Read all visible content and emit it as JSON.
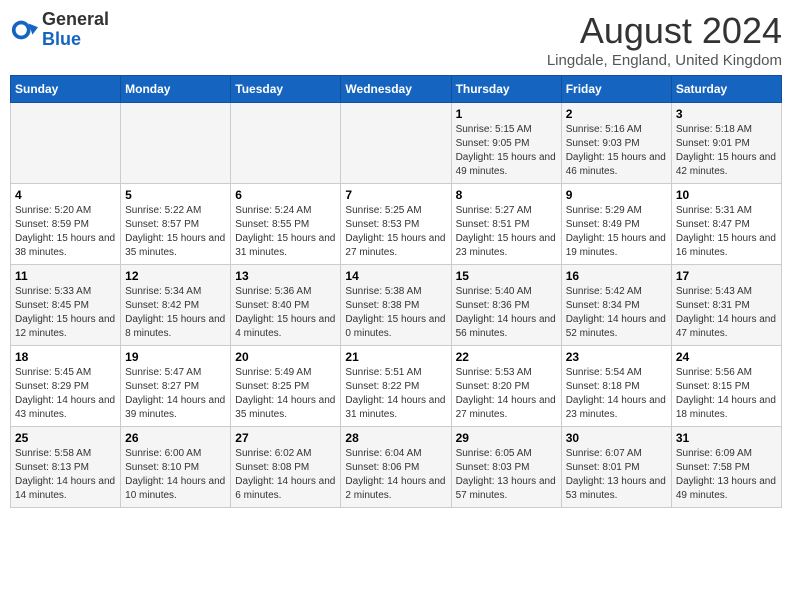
{
  "header": {
    "logo_general": "General",
    "logo_blue": "Blue",
    "month_title": "August 2024",
    "location": "Lingdale, England, United Kingdom"
  },
  "days_of_week": [
    "Sunday",
    "Monday",
    "Tuesday",
    "Wednesday",
    "Thursday",
    "Friday",
    "Saturday"
  ],
  "weeks": [
    [
      {
        "day": "",
        "info": ""
      },
      {
        "day": "",
        "info": ""
      },
      {
        "day": "",
        "info": ""
      },
      {
        "day": "",
        "info": ""
      },
      {
        "day": "1",
        "info": "Sunrise: 5:15 AM\nSunset: 9:05 PM\nDaylight: 15 hours and 49 minutes."
      },
      {
        "day": "2",
        "info": "Sunrise: 5:16 AM\nSunset: 9:03 PM\nDaylight: 15 hours and 46 minutes."
      },
      {
        "day": "3",
        "info": "Sunrise: 5:18 AM\nSunset: 9:01 PM\nDaylight: 15 hours and 42 minutes."
      }
    ],
    [
      {
        "day": "4",
        "info": "Sunrise: 5:20 AM\nSunset: 8:59 PM\nDaylight: 15 hours and 38 minutes."
      },
      {
        "day": "5",
        "info": "Sunrise: 5:22 AM\nSunset: 8:57 PM\nDaylight: 15 hours and 35 minutes."
      },
      {
        "day": "6",
        "info": "Sunrise: 5:24 AM\nSunset: 8:55 PM\nDaylight: 15 hours and 31 minutes."
      },
      {
        "day": "7",
        "info": "Sunrise: 5:25 AM\nSunset: 8:53 PM\nDaylight: 15 hours and 27 minutes."
      },
      {
        "day": "8",
        "info": "Sunrise: 5:27 AM\nSunset: 8:51 PM\nDaylight: 15 hours and 23 minutes."
      },
      {
        "day": "9",
        "info": "Sunrise: 5:29 AM\nSunset: 8:49 PM\nDaylight: 15 hours and 19 minutes."
      },
      {
        "day": "10",
        "info": "Sunrise: 5:31 AM\nSunset: 8:47 PM\nDaylight: 15 hours and 16 minutes."
      }
    ],
    [
      {
        "day": "11",
        "info": "Sunrise: 5:33 AM\nSunset: 8:45 PM\nDaylight: 15 hours and 12 minutes."
      },
      {
        "day": "12",
        "info": "Sunrise: 5:34 AM\nSunset: 8:42 PM\nDaylight: 15 hours and 8 minutes."
      },
      {
        "day": "13",
        "info": "Sunrise: 5:36 AM\nSunset: 8:40 PM\nDaylight: 15 hours and 4 minutes."
      },
      {
        "day": "14",
        "info": "Sunrise: 5:38 AM\nSunset: 8:38 PM\nDaylight: 15 hours and 0 minutes."
      },
      {
        "day": "15",
        "info": "Sunrise: 5:40 AM\nSunset: 8:36 PM\nDaylight: 14 hours and 56 minutes."
      },
      {
        "day": "16",
        "info": "Sunrise: 5:42 AM\nSunset: 8:34 PM\nDaylight: 14 hours and 52 minutes."
      },
      {
        "day": "17",
        "info": "Sunrise: 5:43 AM\nSunset: 8:31 PM\nDaylight: 14 hours and 47 minutes."
      }
    ],
    [
      {
        "day": "18",
        "info": "Sunrise: 5:45 AM\nSunset: 8:29 PM\nDaylight: 14 hours and 43 minutes."
      },
      {
        "day": "19",
        "info": "Sunrise: 5:47 AM\nSunset: 8:27 PM\nDaylight: 14 hours and 39 minutes."
      },
      {
        "day": "20",
        "info": "Sunrise: 5:49 AM\nSunset: 8:25 PM\nDaylight: 14 hours and 35 minutes."
      },
      {
        "day": "21",
        "info": "Sunrise: 5:51 AM\nSunset: 8:22 PM\nDaylight: 14 hours and 31 minutes."
      },
      {
        "day": "22",
        "info": "Sunrise: 5:53 AM\nSunset: 8:20 PM\nDaylight: 14 hours and 27 minutes."
      },
      {
        "day": "23",
        "info": "Sunrise: 5:54 AM\nSunset: 8:18 PM\nDaylight: 14 hours and 23 minutes."
      },
      {
        "day": "24",
        "info": "Sunrise: 5:56 AM\nSunset: 8:15 PM\nDaylight: 14 hours and 18 minutes."
      }
    ],
    [
      {
        "day": "25",
        "info": "Sunrise: 5:58 AM\nSunset: 8:13 PM\nDaylight: 14 hours and 14 minutes."
      },
      {
        "day": "26",
        "info": "Sunrise: 6:00 AM\nSunset: 8:10 PM\nDaylight: 14 hours and 10 minutes."
      },
      {
        "day": "27",
        "info": "Sunrise: 6:02 AM\nSunset: 8:08 PM\nDaylight: 14 hours and 6 minutes."
      },
      {
        "day": "28",
        "info": "Sunrise: 6:04 AM\nSunset: 8:06 PM\nDaylight: 14 hours and 2 minutes."
      },
      {
        "day": "29",
        "info": "Sunrise: 6:05 AM\nSunset: 8:03 PM\nDaylight: 13 hours and 57 minutes."
      },
      {
        "day": "30",
        "info": "Sunrise: 6:07 AM\nSunset: 8:01 PM\nDaylight: 13 hours and 53 minutes."
      },
      {
        "day": "31",
        "info": "Sunrise: 6:09 AM\nSunset: 7:58 PM\nDaylight: 13 hours and 49 minutes."
      }
    ]
  ]
}
